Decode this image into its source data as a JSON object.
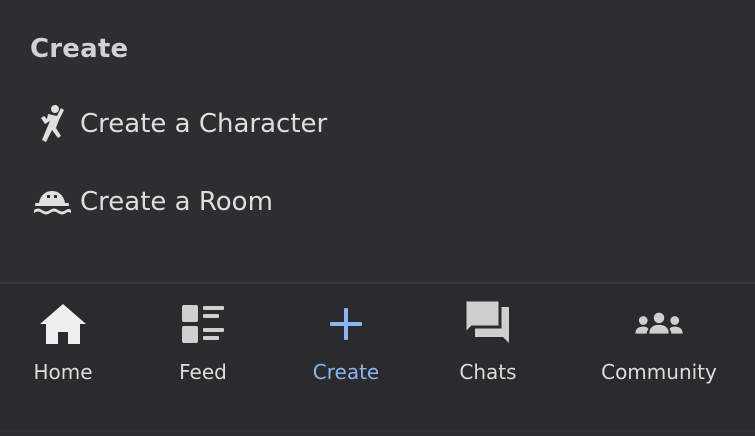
{
  "create_panel": {
    "title": "Create",
    "items": [
      {
        "label": "Create a Character",
        "icon": "character-icon"
      },
      {
        "label": "Create a Room",
        "icon": "room-icon"
      }
    ]
  },
  "bottom_nav": {
    "active": "Create",
    "accent_color": "#8ab4f2",
    "items": [
      {
        "label": "Home",
        "icon": "home-icon"
      },
      {
        "label": "Feed",
        "icon": "feed-icon"
      },
      {
        "label": "Create",
        "icon": "plus-icon"
      },
      {
        "label": "Chats",
        "icon": "chats-icon"
      },
      {
        "label": "Community",
        "icon": "community-icon"
      }
    ]
  }
}
